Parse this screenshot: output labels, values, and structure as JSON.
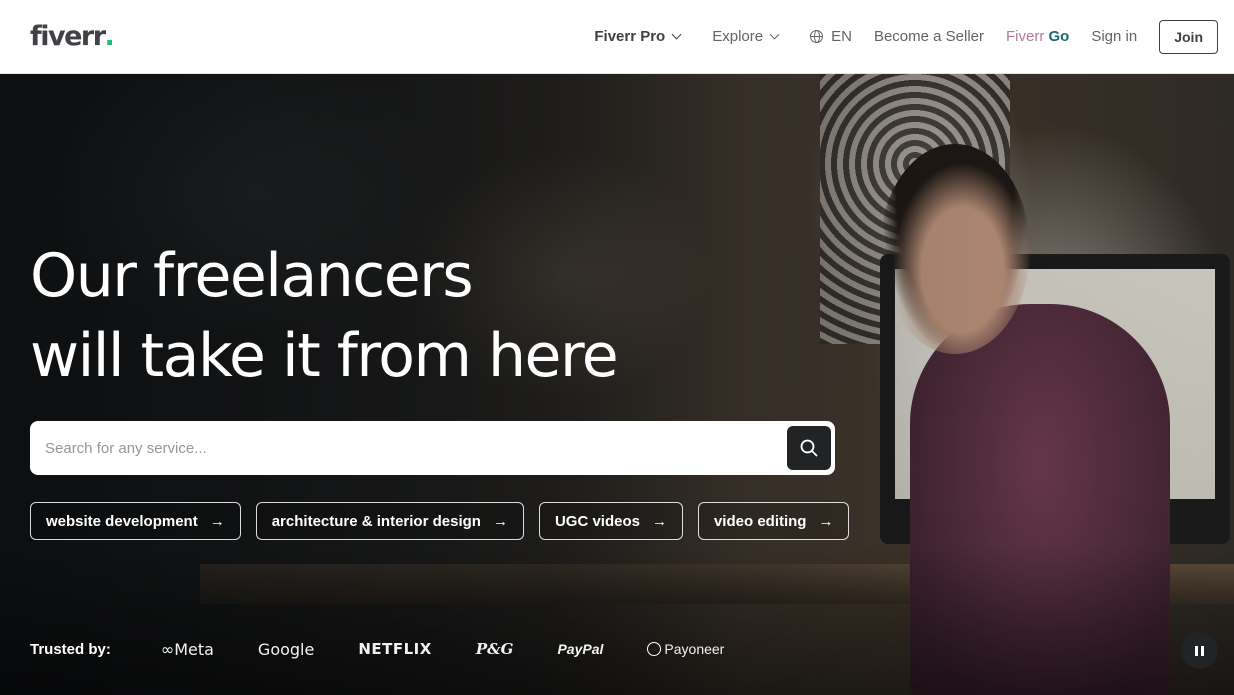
{
  "header": {
    "logo_text": "fiverr",
    "logo_dot": ".",
    "nav": {
      "fiverr_pro": "Fiverr Pro",
      "explore": "Explore",
      "language": "EN",
      "become_seller": "Become a Seller",
      "fiverr_go_a": "Fiverr",
      "fiverr_go_b": "Go",
      "sign_in": "Sign in",
      "join": "Join"
    }
  },
  "hero": {
    "headline_line1": "Our freelancers",
    "headline_line2": "will take it from here",
    "search": {
      "placeholder": "Search for any service..."
    },
    "chips": [
      {
        "label": "website development",
        "arrow": "→"
      },
      {
        "label": "architecture & interior design",
        "arrow": "→"
      },
      {
        "label": "UGC videos",
        "arrow": "→"
      },
      {
        "label": "video editing",
        "arrow": "→"
      }
    ],
    "trusted_label": "Trusted by:",
    "brands": {
      "meta": "Meta",
      "google": "Google",
      "netflix": "NETFLIX",
      "pg": "P&G",
      "paypal": "PayPal",
      "payoneer": "Payoneer"
    }
  },
  "colors": {
    "brand_green": "#1dbf73",
    "text_dark": "#404145",
    "fiverr_go_teal": "#1b6a73",
    "button_dark": "#222325"
  },
  "icons": [
    "chevron-down-icon",
    "globe-icon",
    "search-icon",
    "arrow-right-icon",
    "meta-logo-icon",
    "payoneer-ring-icon",
    "pause-icon"
  ]
}
